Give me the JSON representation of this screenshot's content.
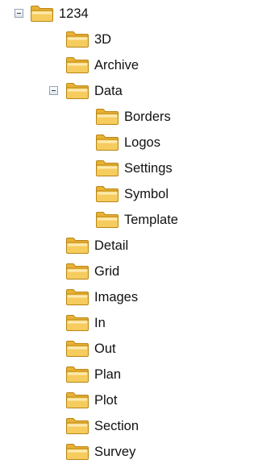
{
  "tree": {
    "root": {
      "label": "1234",
      "expanded": true,
      "icon": "folder-icon"
    },
    "children": [
      {
        "label": "3D",
        "icon": "folder-icon"
      },
      {
        "label": "Archive",
        "icon": "folder-icon"
      },
      {
        "label": "Data",
        "expanded": true,
        "icon": "folder-icon",
        "children": [
          {
            "label": "Borders",
            "icon": "folder-icon"
          },
          {
            "label": "Logos",
            "icon": "folder-icon"
          },
          {
            "label": "Settings",
            "icon": "folder-icon"
          },
          {
            "label": "Symbol",
            "icon": "folder-icon"
          },
          {
            "label": "Template",
            "icon": "folder-icon"
          }
        ]
      },
      {
        "label": "Detail",
        "icon": "folder-icon"
      },
      {
        "label": "Grid",
        "icon": "folder-icon"
      },
      {
        "label": "Images",
        "icon": "folder-icon"
      },
      {
        "label": "In",
        "icon": "folder-icon"
      },
      {
        "label": "Out",
        "icon": "folder-icon"
      },
      {
        "label": "Plan",
        "icon": "folder-icon"
      },
      {
        "label": "Plot",
        "icon": "folder-icon"
      },
      {
        "label": "Section",
        "icon": "folder-icon"
      },
      {
        "label": "Survey",
        "icon": "folder-icon"
      }
    ],
    "colors": {
      "folder_body": "#f6cc5e",
      "folder_back": "#e9b236",
      "folder_outline": "#b98512",
      "expander_border": "#93a0b5"
    }
  }
}
